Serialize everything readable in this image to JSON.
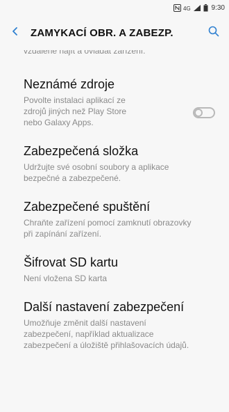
{
  "status_bar": {
    "time": "9:30"
  },
  "header": {
    "title": "ZAMYKACÍ OBR. A ZABEZP."
  },
  "partial_item": {
    "text": "vzdálené najít a ovládat zařízení."
  },
  "items": [
    {
      "title": "Neznámé zdroje",
      "subtitle": "Povolte instalaci aplikací ze zdrojů jiných než Play Store nebo Galaxy Apps.",
      "toggle": false
    },
    {
      "title": "Zabezpečená složka",
      "subtitle": "Udržujte své osobní soubory a aplikace bezpečné a zabezpečené."
    },
    {
      "title": "Zabezpečené spuštění",
      "subtitle": "Chraňte zařízení pomocí zamknutí obrazovky při zapínání zařízení."
    },
    {
      "title": "Šifrovat SD kartu",
      "subtitle": "Není vložena SD karta"
    },
    {
      "title": "Další nastavení zabezpečení",
      "subtitle": "Umožňuje změnit další nastavení zabezpečení, například aktualizace zabezpečení a úložiště přihlašovacích údajů."
    }
  ],
  "colors": {
    "accent": "#2f80d0",
    "background": "#f7f7f7",
    "subtitle": "#8a8a8a"
  }
}
